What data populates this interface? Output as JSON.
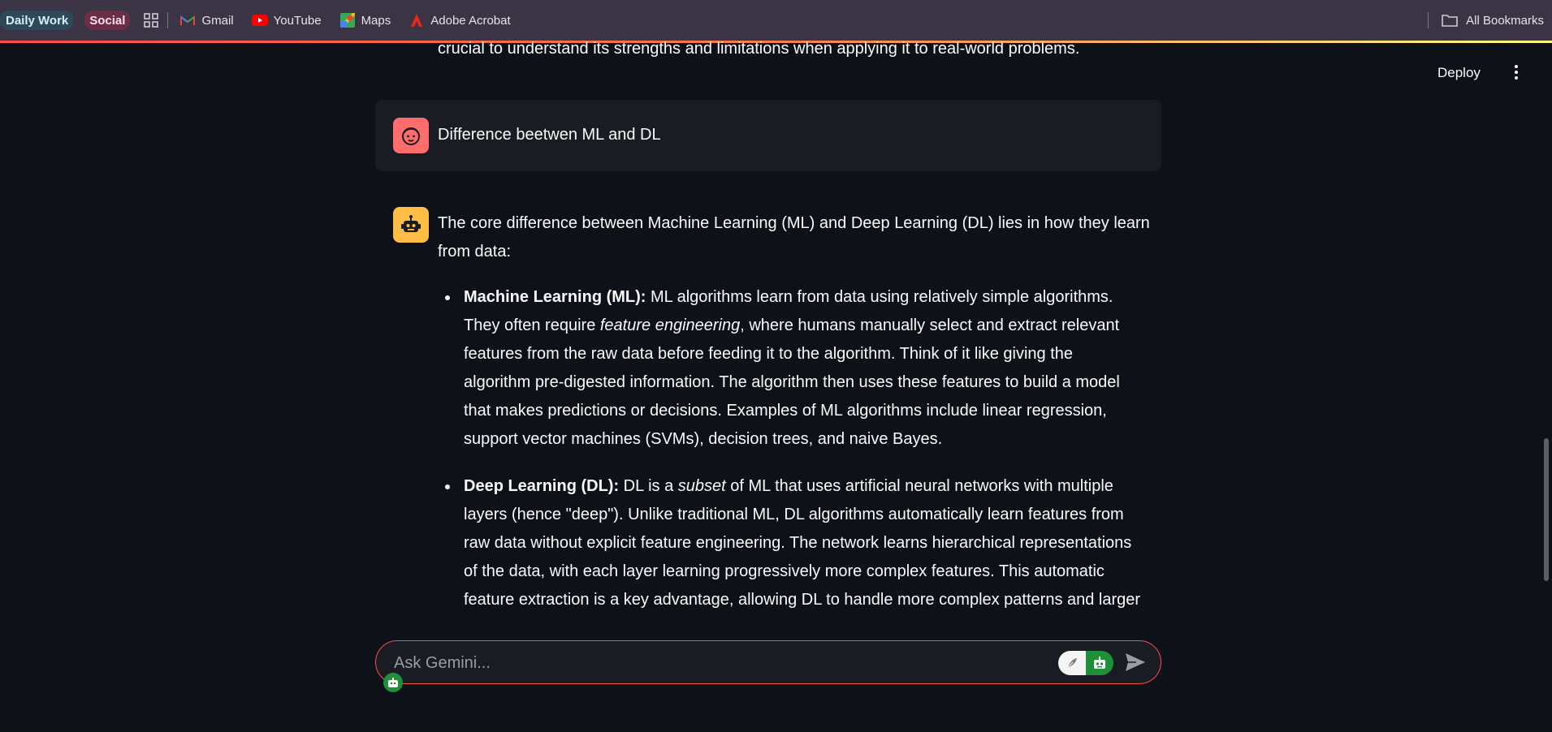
{
  "bookmarks": {
    "groups": [
      "Daily Work",
      "Social"
    ],
    "items": [
      "Gmail",
      "YouTube",
      "Maps",
      "Adobe Acrobat"
    ],
    "all_bookmarks": "All Bookmarks"
  },
  "header": {
    "deploy_label": "Deploy"
  },
  "chat": {
    "previous_tail": "crucial to understand its strengths and limitations when applying it to real-world problems.",
    "user_message": "Difference beetwen ML and DL",
    "bot_intro": [
      "The core difference between Machine Learning (ML) and Deep Learning (DL) lies in how they learn",
      "from data:"
    ],
    "bullet1": {
      "title": "Machine Learning (ML):",
      "l1": " ML algorithms learn from data using relatively simple algorithms.",
      "l2_pre": "They often require ",
      "l2_em": "feature engineering",
      "l2_post": ", where humans manually select and extract relevant",
      "l3": "features from the raw data before feeding it to the algorithm. Think of it like giving the",
      "l4": "algorithm pre-digested information. The algorithm then uses these features to build a model",
      "l5": "that makes predictions or decisions. Examples of ML algorithms include linear regression,",
      "l6": "support vector machines (SVMs), decision trees, and naive Bayes."
    },
    "bullet2": {
      "title": "Deep Learning (DL):",
      "l1_pre": " DL is a ",
      "l1_em": "subset",
      "l1_post": " of ML that uses artificial neural networks with multiple",
      "l2": "layers (hence \"deep\"). Unlike traditional ML, DL algorithms automatically learn features from",
      "l3": "raw data without explicit feature engineering. The network learns hierarchical representations",
      "l4": "of the data, with each layer learning progressively more complex features. This automatic",
      "l5": "feature extraction is a key advantage, allowing DL to handle more complex patterns and larger"
    }
  },
  "input": {
    "placeholder": "Ask Gemini..."
  },
  "colors": {
    "accent": "#ff4b4b",
    "user_avatar": "#ff6c6c",
    "bot_avatar": "#ffbd45",
    "background": "#0e1117"
  }
}
